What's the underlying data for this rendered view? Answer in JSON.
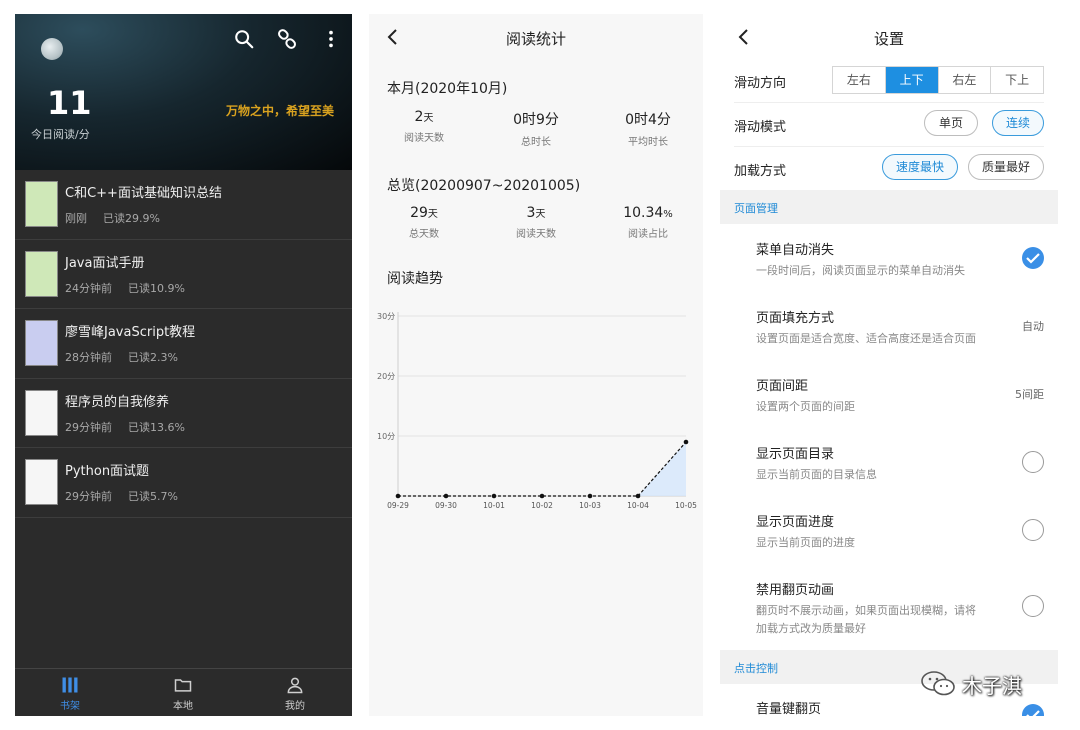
{
  "bookshelf": {
    "today_value": "11",
    "today_label": "今日阅读/分",
    "slogan": "万物之中，希望至美",
    "books": [
      {
        "title": "C和C++面试基础知识总结",
        "time": "刚刚",
        "progress": "已读29.9%"
      },
      {
        "title": "Java面试手册",
        "time": "24分钟前",
        "progress": "已读10.9%"
      },
      {
        "title": "廖雪峰JavaScript教程",
        "time": "28分钟前",
        "progress": "已读2.3%"
      },
      {
        "title": "程序员的自我修养",
        "time": "29分钟前",
        "progress": "已读13.6%"
      },
      {
        "title": "Python面试题",
        "time": "29分钟前",
        "progress": "已读5.7%"
      }
    ],
    "nav": [
      {
        "label": "书架",
        "active": true
      },
      {
        "label": "本地",
        "active": false
      },
      {
        "label": "我的",
        "active": false
      }
    ],
    "accent": "#3f8ee6"
  },
  "stats": {
    "title": "阅读统计",
    "month": {
      "title": "本月(2020年10月)",
      "items": [
        {
          "value": "2",
          "unit": "天",
          "label": "阅读天数"
        },
        {
          "value": "0时9分",
          "unit": "",
          "label": "总时长"
        },
        {
          "value": "0时4分",
          "unit": "",
          "label": "平均时长"
        }
      ]
    },
    "overview": {
      "title": "总览(20200907~20201005)",
      "items": [
        {
          "value": "29",
          "unit": "天",
          "label": "总天数"
        },
        {
          "value": "3",
          "unit": "天",
          "label": "阅读天数"
        },
        {
          "value": "10.34",
          "unit": "%",
          "label": "阅读占比"
        }
      ]
    },
    "trend_title": "阅读趋势"
  },
  "chart_data": {
    "type": "line",
    "categories": [
      "09-29",
      "09-30",
      "10-01",
      "10-02",
      "10-03",
      "10-04",
      "10-05"
    ],
    "values": [
      0,
      0,
      0,
      0,
      0,
      0,
      9
    ],
    "ylim": [
      0,
      30
    ],
    "yticks": [
      10,
      20,
      30
    ],
    "ytick_labels": [
      "10分",
      "20分",
      "30分"
    ],
    "grid": true
  },
  "settings": {
    "title": "设置",
    "direction_label": "滑动方向",
    "direction_options": [
      "左右",
      "上下",
      "右左",
      "下上"
    ],
    "direction_selected": 1,
    "mode_label": "滑动模式",
    "mode_options": [
      "单页",
      "连续"
    ],
    "load_label": "加载方式",
    "load_options": [
      "速度最快",
      "质量最好"
    ],
    "group_page": "页面管理",
    "items": [
      {
        "title": "菜单自动消失",
        "desc": "一段时间后，阅读页面显示的菜单自动消失",
        "checked": true
      },
      {
        "title": "页面填充方式",
        "desc": "设置页面是适合宽度、适合高度还是适合页面",
        "value": "自动"
      },
      {
        "title": "页面间距",
        "desc": "设置两个页面的间距",
        "value": "5间距"
      },
      {
        "title": "显示页面目录",
        "desc": "显示当前页面的目录信息",
        "checked": false
      },
      {
        "title": "显示页面进度",
        "desc": "显示当前页面的进度",
        "checked": false
      },
      {
        "title": "禁用翻页动画",
        "desc_line1": "翻页时不展示动画，如果页面出现模糊，请将",
        "desc_line2": "加载方式改为质量最好",
        "checked": false
      }
    ],
    "group_click": "点击控制",
    "volume_title": "音量键翻页"
  },
  "watermark": "木子淇"
}
